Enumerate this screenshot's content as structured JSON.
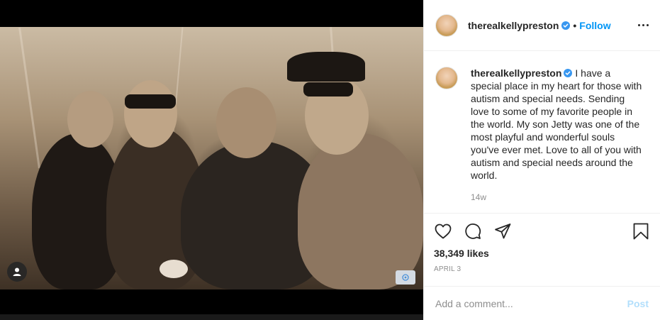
{
  "header": {
    "username": "therealkellypreston",
    "separator": "•",
    "follow_label": "Follow",
    "more_icon": "more-horizontal-icon"
  },
  "caption": {
    "username": "therealkellypreston",
    "text": "I have a special place in my heart for those with autism and special needs. Sending love to some of my favorite people in the world. My son Jetty was one of the most playful and wonderful souls you've ever met. Love to all of you with autism and special needs around the world.",
    "time_ago": "14w"
  },
  "actions": {
    "icons": [
      "heart-icon",
      "comment-icon",
      "share-icon",
      "bookmark-icon"
    ],
    "likes": "38,349 likes",
    "date": "APRIL 3"
  },
  "comment": {
    "placeholder": "Add a comment...",
    "post_label": "Post"
  },
  "colors": {
    "accent": "#0095f6",
    "post_disabled": "#b2dffc",
    "text": "#262626",
    "muted": "#8e8e8e",
    "border": "#efefef"
  }
}
